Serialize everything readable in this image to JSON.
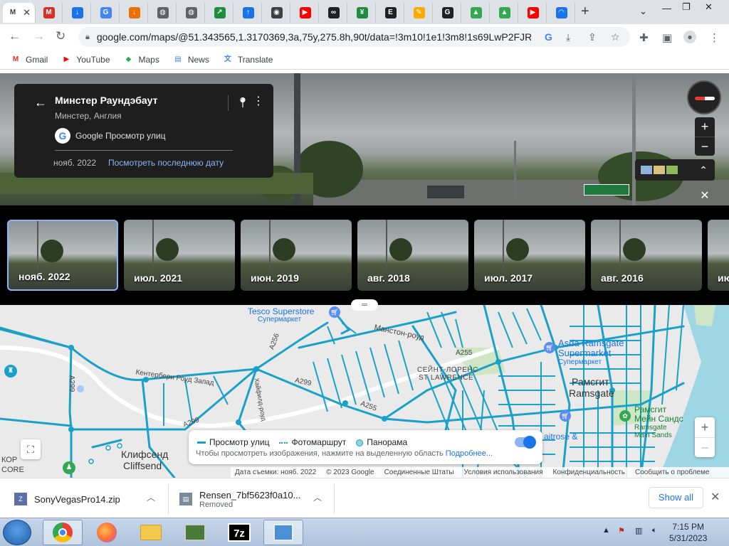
{
  "browser": {
    "tabs": [
      {
        "icon": "maps-icon",
        "letter": "M",
        "color": "#34a853"
      },
      {
        "icon": "gmail-icon",
        "letter": "M",
        "color": "#d93025"
      },
      {
        "icon": "download-icon",
        "letter": "↓",
        "color": "#1a73e8"
      },
      {
        "icon": "google-icon",
        "letter": "G",
        "color": "#4285f4"
      },
      {
        "icon": "download-orange-icon",
        "letter": "↓",
        "color": "#e8710a"
      },
      {
        "icon": "globe-icon",
        "letter": "◍",
        "color": "#5f6368"
      },
      {
        "icon": "globe-icon",
        "letter": "◍",
        "color": "#5f6368"
      },
      {
        "icon": "share-green-icon",
        "letter": "↗",
        "color": "#1e8e3e"
      },
      {
        "icon": "upload-icon",
        "letter": "↑",
        "color": "#1a73e8"
      },
      {
        "icon": "chrome-icon",
        "letter": "◉",
        "color": "#3c4043"
      },
      {
        "icon": "youtube-icon",
        "letter": "▶",
        "color": "#ff0000"
      },
      {
        "icon": "link-icon",
        "letter": "∞",
        "color": "#202124"
      },
      {
        "icon": "spreadsheet-icon",
        "letter": "¥",
        "color": "#1e8e3e"
      },
      {
        "icon": "bracket-icon",
        "letter": "E",
        "color": "#202124"
      },
      {
        "icon": "pencil-icon",
        "letter": "✎",
        "color": "#f9ab00"
      },
      {
        "icon": "g-dark-icon",
        "letter": "G",
        "color": "#202124"
      },
      {
        "icon": "drive-icon",
        "letter": "▲",
        "color": "#34a853"
      },
      {
        "icon": "drive-icon",
        "letter": "▲",
        "color": "#34a853"
      },
      {
        "icon": "youtube-icon",
        "letter": "▶",
        "color": "#ff0000"
      },
      {
        "icon": "loading-icon",
        "letter": "◠",
        "color": "#1a73e8"
      }
    ],
    "active_tab_letter": "M",
    "new_tab": "+",
    "url": "google.com/maps/@51.343565,1.3170369,3a,75y,275.8h,90t/data=!3m10!1e1!3m8!1s69LwP2FJR...",
    "bookmarks": [
      {
        "label": "Gmail",
        "icon": "gmail-icon"
      },
      {
        "label": "YouTube",
        "icon": "youtube-icon"
      },
      {
        "label": "Maps",
        "icon": "maps-pin-icon"
      },
      {
        "label": "News",
        "icon": "news-icon"
      },
      {
        "label": "Translate",
        "icon": "translate-icon"
      }
    ]
  },
  "streetview": {
    "title": "Минстер Раундэбаут",
    "subtitle": "Минстер, Англия",
    "provider": "Google Просмотр улиц",
    "date": "нояб. 2022",
    "latest_link": "Посмотреть последнюю дату"
  },
  "timeline": [
    {
      "label": "нояб. 2022",
      "selected": true
    },
    {
      "label": "июл. 2021",
      "selected": false
    },
    {
      "label": "июн. 2019",
      "selected": false
    },
    {
      "label": "авг. 2018",
      "selected": false
    },
    {
      "label": "июл. 2017",
      "selected": false
    },
    {
      "label": "авг. 2016",
      "selected": false
    },
    {
      "label": "ию",
      "selected": false
    }
  ],
  "map": {
    "labels": {
      "tesco": "Tesco Superstore",
      "tesco_sub": "Супермаркет",
      "manston": "Манстон-роуд",
      "a256": "A256",
      "a255a": "A255",
      "a255b": "A255",
      "a299a": "A299",
      "a299b": "A299",
      "a299c": "A299",
      "canterbury": "Кентербери Роуд Запад",
      "stlaw_ru": "СЕЙНТ-ЛОРЕНС",
      "stlaw_en": "ST LAWRENCE",
      "asda": "Asda Ramsgate",
      "asda2": "Supermarket",
      "asda_sub": "Супермаркет",
      "ramsgate_ru": "Рамсгит",
      "ramsgate_en": "Ramsgate",
      "sands_ru": "Рамсгит",
      "sands_ru2": "Мейн Сандс",
      "sands_en": "Ramsgate",
      "sands_en2": "Main Sands",
      "waitrose": "aitrose &",
      "cliffsend_ru": "Клифсенд",
      "cliffsend_en": "Cliffsend",
      "kor": "КОР",
      "core": "CORE",
      "vert_road": "Хайфилд-роуд"
    },
    "legend": {
      "streetview": "Просмотр улиц",
      "photo_route": "Фотомаршрут",
      "panorama": "Панорама",
      "hint": "Чтобы просмотреть изображения, нажмите на выделенную область",
      "more": "Подробнее..."
    },
    "attribution": [
      "Дата съемки: нояб. 2022",
      "© 2023 Google",
      "Соединенные Штаты",
      "Условия использования",
      "Конфиденциальность",
      "Сообщить о проблеме"
    ]
  },
  "downloads": {
    "items": [
      {
        "name": "SonyVegasPro14.zip",
        "status": ""
      },
      {
        "name": "Rensen_7bf5623f0a10...",
        "status": "Removed"
      }
    ],
    "show_all": "Show all"
  },
  "taskbar": {
    "time": "7:15 PM",
    "date": "5/31/2023"
  },
  "colors": {
    "accent": "#1a73e8",
    "streetview_coverage": "#1aa1c7",
    "card_bg": "#1e1e1e"
  }
}
